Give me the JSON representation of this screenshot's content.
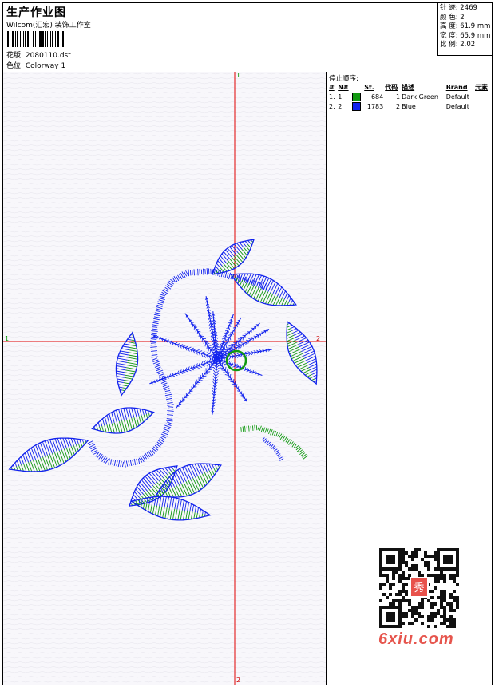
{
  "header": {
    "title": "生产作业图",
    "company": "Wilcom(汇宏) 装饰工作室",
    "design_label": "花版: 2080110.dst",
    "colorway_label": "色位:  Colorway 1"
  },
  "stats": {
    "stitches": "针 迹: 2469",
    "colors": "颜 色: 2",
    "height": "高 度: 61.9 mm",
    "width": "宽 度: 65.9 mm",
    "scale": "比 例: 2.02"
  },
  "stop_sequence": {
    "title": "停止顺序:",
    "headers": [
      "#",
      "N#",
      "",
      "St.",
      "代码",
      "描述",
      "Brand",
      "元素"
    ],
    "rows": [
      {
        "num": "1.",
        "n": "1",
        "color": "#119911",
        "stitches": "684",
        "code": "1",
        "desc": "Dark Green",
        "brand": "Default",
        "element": ""
      },
      {
        "num": "2.",
        "n": "2",
        "color": "#1122ee",
        "stitches": "1783",
        "code": "2",
        "desc": "Blue",
        "brand": "Default",
        "element": ""
      }
    ]
  },
  "axis_markers": {
    "top": "1",
    "left": "1",
    "right": "2",
    "bottom": "2"
  },
  "watermark": "6xiu.com",
  "qr_center_text": "秀",
  "colors": {
    "green": "#119911",
    "blue": "#1122ee",
    "crosshair": "#e00000"
  }
}
